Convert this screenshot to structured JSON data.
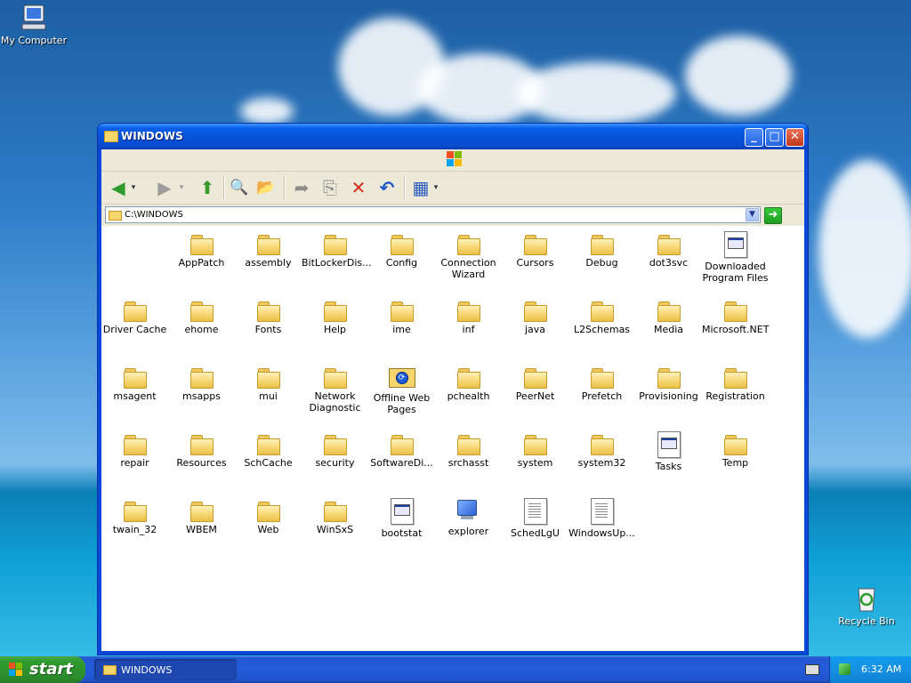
{
  "desktop": {
    "icons": [
      {
        "label": "My Computer"
      },
      {
        "label": "Recycle Bin"
      }
    ]
  },
  "window": {
    "title": "WINDOWS",
    "address": "C:\\WINDOWS",
    "buttons": {
      "minimize": "_",
      "maximize": "□",
      "close": "✕"
    }
  },
  "toolbar": {
    "back": "◀",
    "forward": "▶",
    "up": "⬆",
    "search": "🔍",
    "folders": "📂",
    "move_to": "➦",
    "copy_to": "⎘",
    "delete": "✕",
    "undo": "↶",
    "views": "▦"
  },
  "files": [
    {
      "name": "AppPatch",
      "type": "folder"
    },
    {
      "name": "assembly",
      "type": "folder"
    },
    {
      "name": "BitLockerDis...",
      "type": "folder"
    },
    {
      "name": "Config",
      "type": "folder"
    },
    {
      "name": "Connection Wizard",
      "type": "folder"
    },
    {
      "name": "Cursors",
      "type": "folder"
    },
    {
      "name": "Debug",
      "type": "folder"
    },
    {
      "name": "dot3svc",
      "type": "folder"
    },
    {
      "name": "Downloaded Program Files",
      "type": "sysfile"
    },
    {
      "name": "Driver Cache",
      "type": "folder"
    },
    {
      "name": "ehome",
      "type": "folder"
    },
    {
      "name": "Fonts",
      "type": "folder"
    },
    {
      "name": "Help",
      "type": "folder"
    },
    {
      "name": "ime",
      "type": "folder"
    },
    {
      "name": "inf",
      "type": "folder"
    },
    {
      "name": "java",
      "type": "folder"
    },
    {
      "name": "L2Schemas",
      "type": "folder"
    },
    {
      "name": "Media",
      "type": "folder"
    },
    {
      "name": "Microsoft.NET",
      "type": "folder"
    },
    {
      "name": "msagent",
      "type": "folder"
    },
    {
      "name": "msapps",
      "type": "folder"
    },
    {
      "name": "mui",
      "type": "folder"
    },
    {
      "name": "Network Diagnostic",
      "type": "folder"
    },
    {
      "name": "Offline Web Pages",
      "type": "offline"
    },
    {
      "name": "pchealth",
      "type": "folder"
    },
    {
      "name": "PeerNet",
      "type": "folder"
    },
    {
      "name": "Prefetch",
      "type": "folder"
    },
    {
      "name": "Provisioning",
      "type": "folder"
    },
    {
      "name": "Registration",
      "type": "folder"
    },
    {
      "name": "repair",
      "type": "folder"
    },
    {
      "name": "Resources",
      "type": "folder"
    },
    {
      "name": "SchCache",
      "type": "folder"
    },
    {
      "name": "security",
      "type": "folder"
    },
    {
      "name": "SoftwareDi...",
      "type": "folder"
    },
    {
      "name": "srchasst",
      "type": "folder"
    },
    {
      "name": "system",
      "type": "folder"
    },
    {
      "name": "system32",
      "type": "folder"
    },
    {
      "name": "Tasks",
      "type": "sysfile"
    },
    {
      "name": "Temp",
      "type": "folder"
    },
    {
      "name": "twain_32",
      "type": "folder"
    },
    {
      "name": "WBEM",
      "type": "folder"
    },
    {
      "name": "Web",
      "type": "folder"
    },
    {
      "name": "WinSxS",
      "type": "folder"
    },
    {
      "name": "bootstat",
      "type": "sysfile"
    },
    {
      "name": "explorer",
      "type": "exe"
    },
    {
      "name": "SchedLgU",
      "type": "text"
    },
    {
      "name": "WindowsUp...",
      "type": "text"
    }
  ],
  "taskbar": {
    "start_label": "start",
    "task_title": "WINDOWS",
    "clock": "6:32 AM"
  },
  "colors": {
    "title_bar": "#0a5fe8",
    "taskbar": "#245dda",
    "start": "#2f9b2f"
  }
}
